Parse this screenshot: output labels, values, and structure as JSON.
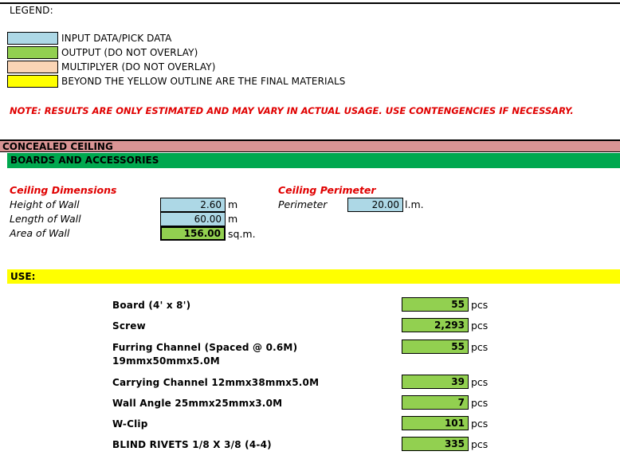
{
  "legend": {
    "title": "LEGEND:",
    "items": [
      {
        "label": "INPUT DATA/PICK DATA",
        "color": "#add8e6"
      },
      {
        "label": "OUTPUT (DO NOT OVERLAY)",
        "color": "#92d050"
      },
      {
        "label": "MULTIPLYER (DO NOT OVERLAY)",
        "color": "#fbd5b5"
      },
      {
        "label": "BEYOND THE YELLOW OUTLINE ARE THE FINAL MATERIALS",
        "color": "#ffff00"
      }
    ]
  },
  "note": "NOTE: RESULTS ARE ONLY ESTIMATED AND MAY VARY IN ACTUAL USAGE. USE CONTENGENCIES IF NECESSARY.",
  "section": {
    "title": "CONCEALED CEILING",
    "subtitle": "BOARDS AND ACCESSORIES"
  },
  "dimensions": {
    "heading": "Ceiling Dimensions",
    "height": {
      "label": "Height of Wall",
      "value": "2.60",
      "unit": "m"
    },
    "length": {
      "label": "Length of Wall",
      "value": "60.00",
      "unit": "m"
    },
    "area": {
      "label": "Area of Wall",
      "value": "156.00",
      "unit": "sq.m."
    }
  },
  "perimeter": {
    "heading": "Ceiling Perimeter",
    "label": "Perimeter",
    "value": "20.00",
    "unit": "l.m."
  },
  "use": {
    "title": "USE:",
    "items": [
      {
        "label": "Board (4' x 8')",
        "value": "55",
        "unit": "pcs"
      },
      {
        "label": "Screw",
        "value": "2,293",
        "unit": "pcs"
      },
      {
        "label": "Furring Channel (Spaced @ 0.6M)",
        "label2": "19mmx50mmx5.0M",
        "value": "55",
        "unit": "pcs"
      },
      {
        "label": "Carrying Channel 12mmx38mmx5.0M",
        "value": "39",
        "unit": "pcs"
      },
      {
        "label": "Wall Angle 25mmx25mmx3.0M",
        "value": "7",
        "unit": "pcs"
      },
      {
        "label": "W-Clip",
        "value": "101",
        "unit": "pcs"
      },
      {
        "label": "BLIND RIVETS 1/8 X 3/8 (4-4)",
        "value": "335",
        "unit": "pcs"
      }
    ]
  }
}
